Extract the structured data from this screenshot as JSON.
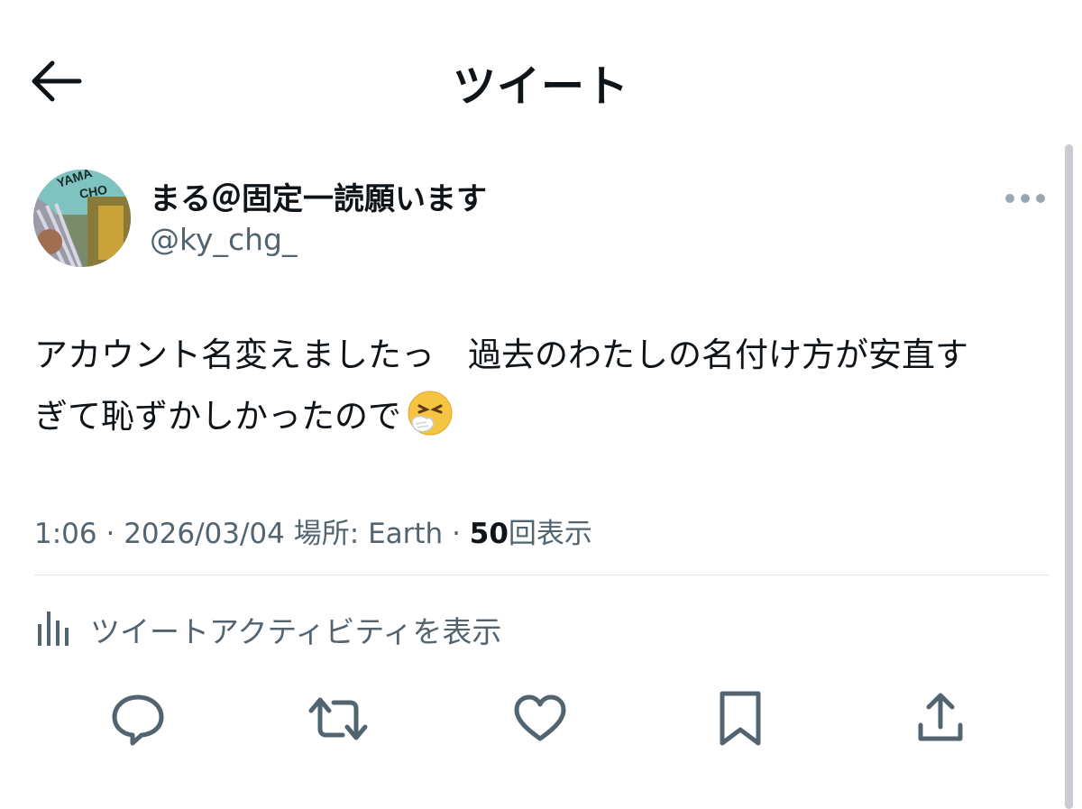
{
  "header": {
    "title": "ツイート",
    "back_icon": "arrow-left-icon"
  },
  "author": {
    "display_name": "まる＠固定一読願います",
    "handle": "@ky_chg_",
    "avatar_text_1": "YAMA",
    "avatar_text_2": "CHO"
  },
  "tweet": {
    "line1": "アカウント名変えましたっ　過去のわたしの名付け方が安直す",
    "line2": "ぎて恥ずかしかったので",
    "emoji": "sneezing-face"
  },
  "meta": {
    "time": "1:06",
    "separator": "·",
    "date": "2026/03/04",
    "location_label": "場所:",
    "location": "Earth",
    "views": "50",
    "views_label": "回表示"
  },
  "activity_link": "ツイートアクティビティを表示",
  "actions": [
    "reply-icon",
    "retweet-icon",
    "like-icon",
    "bookmark-icon",
    "share-icon"
  ],
  "colors": {
    "text": "#0f1419",
    "secondary": "#536471",
    "divider": "#e1e5e8"
  }
}
